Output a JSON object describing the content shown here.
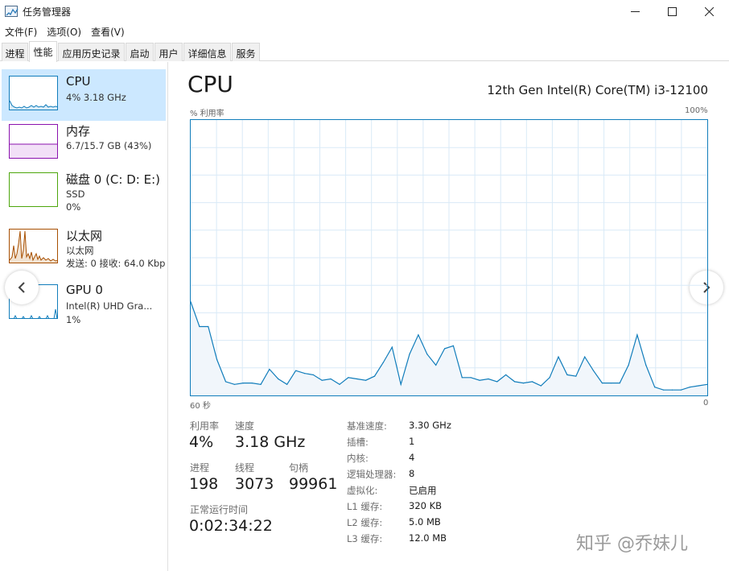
{
  "window": {
    "title": "任务管理器"
  },
  "menu": [
    "文件(F)",
    "选项(O)",
    "查看(V)"
  ],
  "tabs": [
    "进程",
    "性能",
    "应用历史记录",
    "启动",
    "用户",
    "详细信息",
    "服务"
  ],
  "active_tab": "性能",
  "resources": [
    {
      "name": "CPU",
      "line1": "4% 3.18 GHz",
      "line2": "",
      "color": "#117dbb"
    },
    {
      "name": "内存",
      "line1": "6.7/15.7 GB (43%)",
      "line2": "",
      "color": "#8b12ae"
    },
    {
      "name": "磁盘 0 (C: D: E:)",
      "line1": "SSD",
      "line2": "0%",
      "color": "#4da60c"
    },
    {
      "name": "以太网",
      "line1": "以太网",
      "line2": "发送: 0 接收: 64.0 Kbp",
      "color": "#a74f01"
    },
    {
      "name": "GPU 0",
      "line1": "Intel(R) UHD Gra...",
      "line2": "1%",
      "color": "#117dbb"
    }
  ],
  "main": {
    "title": "CPU",
    "model": "12th Gen Intel(R) Core(TM) i3-12100",
    "y_label": "% 利用率",
    "y_max": "100%",
    "x_left": "60 秒",
    "x_right": "0"
  },
  "chart_data": {
    "type": "area",
    "ylim": [
      0,
      100
    ],
    "xlim": [
      60,
      0
    ],
    "grid": true,
    "series": [
      {
        "values": [
          34,
          25,
          25,
          13,
          5,
          4,
          4.5,
          4.5,
          4,
          9.5,
          6,
          4,
          9,
          8,
          7.5,
          5.5,
          6,
          4,
          6.5,
          6,
          5.5,
          7,
          12,
          17.5,
          4,
          15,
          22,
          15,
          11,
          17,
          18,
          6.5,
          6.5,
          5.5,
          6,
          5,
          7.5,
          5,
          4.5,
          5,
          3.5,
          6.5,
          14,
          7.5,
          7,
          14,
          9,
          4.5,
          4.5,
          4.5,
          11,
          22,
          11,
          3,
          2,
          2,
          2,
          3,
          3.5,
          4
        ]
      }
    ]
  },
  "stats": {
    "utilization": {
      "label": "利用率",
      "value": "4%"
    },
    "speed": {
      "label": "速度",
      "value": "3.18 GHz"
    },
    "processes": {
      "label": "进程",
      "value": "198"
    },
    "threads": {
      "label": "线程",
      "value": "3073"
    },
    "handles": {
      "label": "句柄",
      "value": "99961"
    },
    "uptime": {
      "label": "正常运行时间",
      "value": "0:02:34:22"
    }
  },
  "specs": [
    {
      "label": "基准速度:",
      "value": "3.30 GHz"
    },
    {
      "label": "插槽:",
      "value": "1"
    },
    {
      "label": "内核:",
      "value": "4"
    },
    {
      "label": "逻辑处理器:",
      "value": "8"
    },
    {
      "label": "虚拟化:",
      "value": "已启用"
    },
    {
      "label": "L1 缓存:",
      "value": "320 KB"
    },
    {
      "label": "L2 缓存:",
      "value": "5.0 MB"
    },
    {
      "label": "L3 缓存:",
      "value": "12.0 MB"
    }
  ],
  "watermark": "知乎 @乔妹儿",
  "icons": {
    "app": "task-manager-icon",
    "minimize": "minimize-icon",
    "maximize": "maximize-icon",
    "close": "close-icon",
    "prev": "chevron-left-icon",
    "next": "chevron-right-icon"
  }
}
